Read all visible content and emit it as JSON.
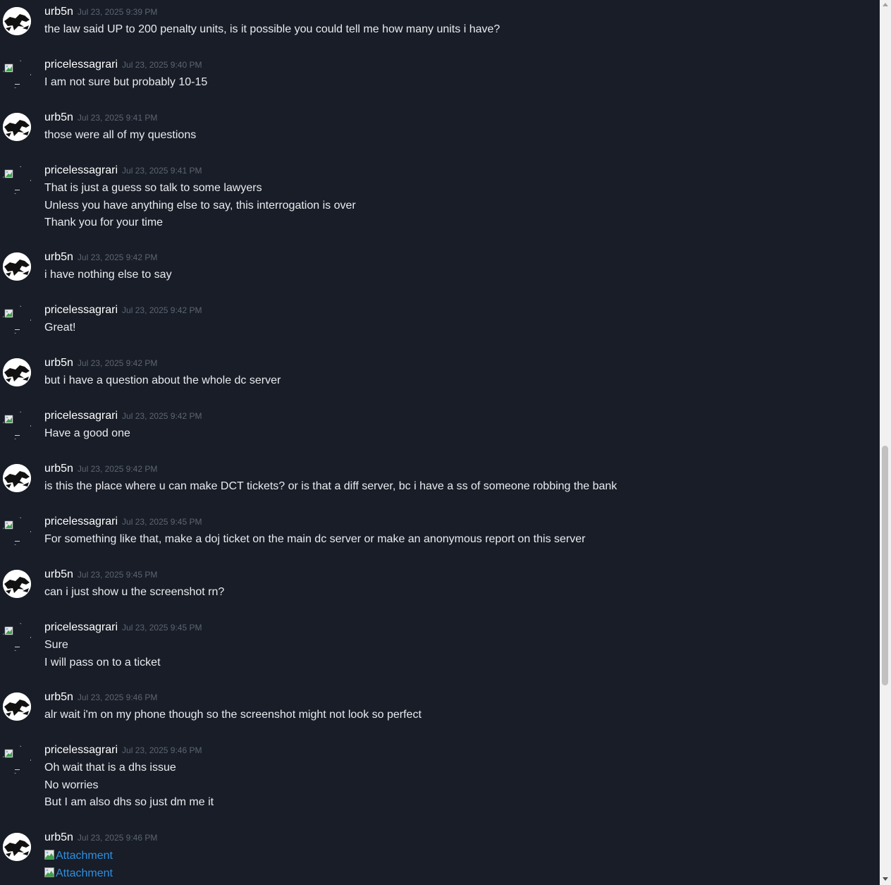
{
  "users": {
    "urb5n": {
      "name": "urb5n",
      "avatar_icon": "urb5n-avatar-icon"
    },
    "pricelessagrari": {
      "name": "pricelessagrari",
      "avatar_icon": "broken-image-icon"
    }
  },
  "messages": [
    {
      "author": "urb5n",
      "timestamp": "Jul 23, 2025 9:39 PM",
      "lines": [
        "the law said UP to 200 penalty units, is it possible you could tell me how many units i have?"
      ]
    },
    {
      "author": "pricelessagrari",
      "timestamp": "Jul 23, 2025 9:40 PM",
      "lines": [
        "I am not sure but probably 10-15"
      ]
    },
    {
      "author": "urb5n",
      "timestamp": "Jul 23, 2025 9:41 PM",
      "lines": [
        "those were all of my questions"
      ]
    },
    {
      "author": "pricelessagrari",
      "timestamp": "Jul 23, 2025 9:41 PM",
      "lines": [
        "That is just a guess so talk to some lawyers",
        "Unless you have anything else to say, this interrogation is over",
        "Thank you for your time"
      ]
    },
    {
      "author": "urb5n",
      "timestamp": "Jul 23, 2025 9:42 PM",
      "lines": [
        "i have nothing else to say"
      ]
    },
    {
      "author": "pricelessagrari",
      "timestamp": "Jul 23, 2025 9:42 PM",
      "lines": [
        "Great!"
      ]
    },
    {
      "author": "urb5n",
      "timestamp": "Jul 23, 2025 9:42 PM",
      "lines": [
        "but i have a question about the whole dc server"
      ]
    },
    {
      "author": "pricelessagrari",
      "timestamp": "Jul 23, 2025 9:42 PM",
      "lines": [
        "Have a good one"
      ]
    },
    {
      "author": "urb5n",
      "timestamp": "Jul 23, 2025 9:42 PM",
      "lines": [
        "is this the place where u can make DCT tickets? or is that a diff server, bc i have a ss of someone robbing the bank"
      ]
    },
    {
      "author": "pricelessagrari",
      "timestamp": "Jul 23, 2025 9:45 PM",
      "lines": [
        "For something like that, make a doj ticket on the main dc server or make an anonymous report on this server"
      ]
    },
    {
      "author": "urb5n",
      "timestamp": "Jul 23, 2025 9:45 PM",
      "lines": [
        "can i just show u the screenshot rn?"
      ]
    },
    {
      "author": "pricelessagrari",
      "timestamp": "Jul 23, 2025 9:45 PM",
      "lines": [
        "Sure",
        "I will pass on to a ticket"
      ]
    },
    {
      "author": "urb5n",
      "timestamp": "Jul 23, 2025 9:46 PM",
      "lines": [
        "alr wait i'm on my phone though so the screenshot might not look so perfect"
      ]
    },
    {
      "author": "pricelessagrari",
      "timestamp": "Jul 23, 2025 9:46 PM",
      "lines": [
        "Oh wait that is a dhs issue",
        "No worries",
        "But I am also dhs so just dm me it"
      ]
    },
    {
      "author": "urb5n",
      "timestamp": "Jul 23, 2025 9:46 PM",
      "lines": [],
      "attachments": [
        "Attachment",
        "Attachment"
      ]
    }
  ],
  "colors": {
    "background": "#181d27",
    "author": "#ffffff",
    "timestamp": "#5d6572",
    "text": "#e9ebef",
    "link": "#2f8fe0"
  }
}
